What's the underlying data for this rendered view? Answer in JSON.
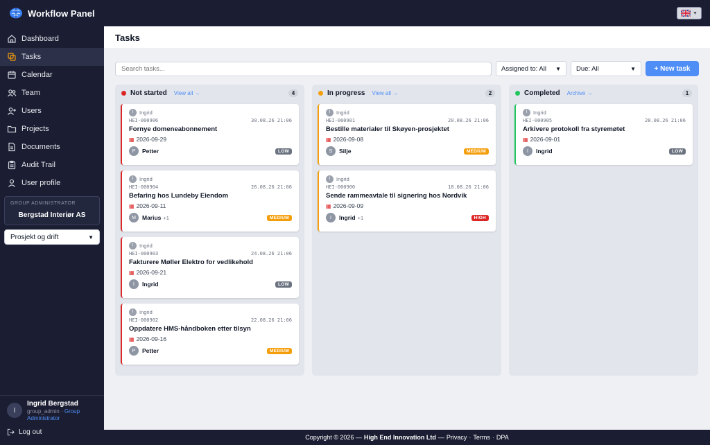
{
  "app": {
    "title": "Workflow Panel"
  },
  "colors": {
    "accent": "#4f8ef7",
    "sidebar": "#1b1e33",
    "low": "#6b7280",
    "medium": "#f59e0b",
    "high": "#dc2626",
    "not_started": "#dc2626",
    "in_progress": "#f59e0b",
    "completed": "#22c55e"
  },
  "sidebar": {
    "items": [
      {
        "label": "Dashboard",
        "icon": "home-icon"
      },
      {
        "label": "Tasks",
        "icon": "tasks-icon",
        "active": true
      },
      {
        "label": "Calendar",
        "icon": "calendar-icon"
      },
      {
        "label": "Team",
        "icon": "team-icon"
      },
      {
        "label": "Users",
        "icon": "user-plus-icon"
      },
      {
        "label": "Projects",
        "icon": "folder-icon"
      },
      {
        "label": "Documents",
        "icon": "document-icon"
      },
      {
        "label": "Audit Trail",
        "icon": "clipboard-icon"
      },
      {
        "label": "User profile",
        "icon": "user-icon"
      }
    ],
    "org": {
      "label": "Group Administrator",
      "name": "Bergstad Interiør AS"
    },
    "select_value": "Prosjekt og drift",
    "user": {
      "initial": "I",
      "name": "Ingrid Bergstad",
      "username": "group_admin",
      "separator": "·",
      "role": "Group Administrator"
    },
    "logout": "Log out"
  },
  "page": {
    "title": "Tasks"
  },
  "toolbar": {
    "search_placeholder": "Search tasks...",
    "assigned": "Assigned to: All",
    "due": "Due: All",
    "new_task": "+ New task"
  },
  "columns": [
    {
      "title": "Not started",
      "link": "View all →",
      "count": "4",
      "cards": [
        {
          "creator_initial": "I",
          "creator": "Ingrid",
          "id": "HEI-000906",
          "created": "30.08.26 21:06",
          "title": "Fornye domeneabonnement",
          "due": "2026-09-29",
          "assignee_initial": "P",
          "assignee": "Petter",
          "extra": "",
          "priority": "LOW"
        },
        {
          "creator_initial": "I",
          "creator": "Ingrid",
          "id": "HEI-000904",
          "created": "26.08.26 21:06",
          "title": "Befaring hos Lundeby Eiendom",
          "due": "2026-09-11",
          "assignee_initial": "M",
          "assignee": "Marius",
          "extra": "+1",
          "priority": "MEDIUM"
        },
        {
          "creator_initial": "I",
          "creator": "Ingrid",
          "id": "HEI-000903",
          "created": "24.08.26 21:06",
          "title": "Fakturere Møller Elektro for vedlikehold",
          "due": "2026-09-21",
          "assignee_initial": "I",
          "assignee": "Ingrid",
          "extra": "",
          "priority": "LOW"
        },
        {
          "creator_initial": "I",
          "creator": "Ingrid",
          "id": "HEI-000902",
          "created": "22.08.26 21:06",
          "title": "Oppdatere HMS-håndboken etter tilsyn",
          "due": "2026-09-16",
          "assignee_initial": "P",
          "assignee": "Petter",
          "extra": "",
          "priority": "MEDIUM"
        }
      ]
    },
    {
      "title": "In progress",
      "link": "View all →",
      "count": "2",
      "cards": [
        {
          "creator_initial": "I",
          "creator": "Ingrid",
          "id": "HEI-000901",
          "created": "20.08.26 21:06",
          "title": "Bestille materialer til Skøyen-prosjektet",
          "due": "2026-09-08",
          "assignee_initial": "S",
          "assignee": "Silje",
          "extra": "",
          "priority": "MEDIUM"
        },
        {
          "creator_initial": "I",
          "creator": "Ingrid",
          "id": "HEI-000900",
          "created": "18.08.26 21:06",
          "title": "Sende rammeavtale til signering hos Nordvik",
          "due": "2026-09-09",
          "assignee_initial": "I",
          "assignee": "Ingrid",
          "extra": "+1",
          "priority": "HIGH"
        }
      ]
    },
    {
      "title": "Completed",
      "link": "Archive →",
      "count": "1",
      "cards": [
        {
          "creator_initial": "I",
          "creator": "Ingrid",
          "id": "HEI-000905",
          "created": "28.08.26 21:06",
          "title": "Arkivere protokoll fra styremøtet",
          "due": "2026-09-01",
          "assignee_initial": "I",
          "assignee": "Ingrid",
          "extra": "",
          "priority": "LOW"
        }
      ]
    }
  ],
  "footer": {
    "copyright": "Copyright © 2026 —",
    "company": "High End Innovation Ltd",
    "dash": "—",
    "privacy": "Privacy",
    "dot": "·",
    "terms": "Terms",
    "dpa": "DPA"
  }
}
